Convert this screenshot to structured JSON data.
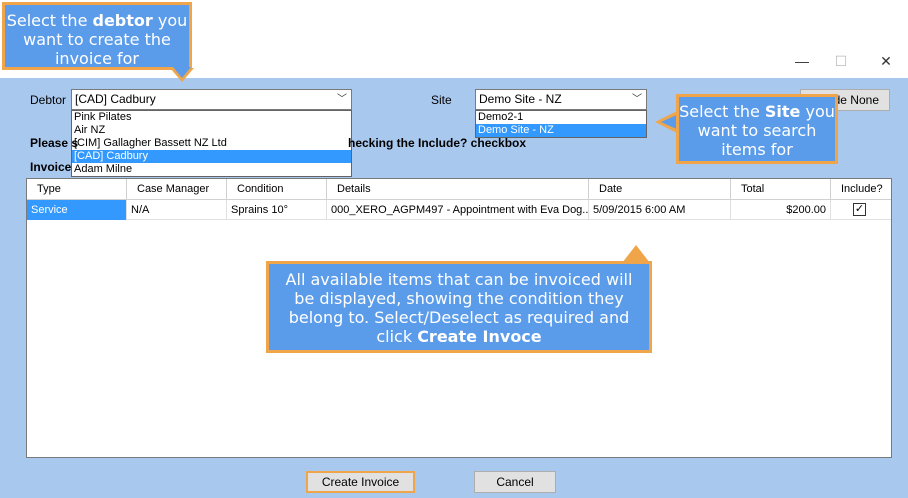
{
  "window": {
    "minimize_glyph": "—",
    "maximize_glyph": "☐",
    "close_glyph": "✕"
  },
  "debtor": {
    "label": "Debtor",
    "selected": "[CAD] Cadbury",
    "options": [
      "Pink Pilates",
      "Air NZ",
      "[CIM] Gallagher Bassett NZ Ltd",
      "[CAD] Cadbury",
      "Adam Milne"
    ],
    "selected_index": 3
  },
  "site": {
    "label": "Site",
    "selected": "Demo Site - NZ",
    "options": [
      "Demo2-1",
      "Demo Site - NZ"
    ],
    "selected_index": 1
  },
  "include_none_label": "de None",
  "instruction_left": "Please s",
  "instruction_right": "hecking the Include? checkbox",
  "invoice_label": "Invoice",
  "table": {
    "headers": [
      "Type",
      "Case Manager",
      "Condition",
      "Details",
      "Date",
      "Total",
      "Include?"
    ],
    "rows": [
      {
        "type": "Service",
        "case_manager": "N/A",
        "condition": "Sprains 10°",
        "details": "000_XERO_AGPM497 - Appointment with Eva Dog...",
        "date": "5/09/2015 6:00 AM",
        "total": "$200.00",
        "include": "✓"
      }
    ]
  },
  "buttons": {
    "create_invoice": "Create Invoice",
    "cancel": "Cancel"
  },
  "callouts": {
    "debtor": {
      "pre": "Select the ",
      "bold": "debtor",
      "post": " you want to create the invoice for"
    },
    "site": {
      "pre": "Select the ",
      "bold": "Site",
      "post": " you want to search items for"
    },
    "items": {
      "pre": "All available items that can be invoiced will be displayed, showing the condition they belong to. Select/Deselect as required and click ",
      "bold": "Create Invoce",
      "post": ""
    }
  },
  "colors": {
    "client_bg": "#a9c8ee",
    "callout_bg": "#5b9cea",
    "callout_border": "#f0a54a",
    "selection": "#3399ff"
  }
}
